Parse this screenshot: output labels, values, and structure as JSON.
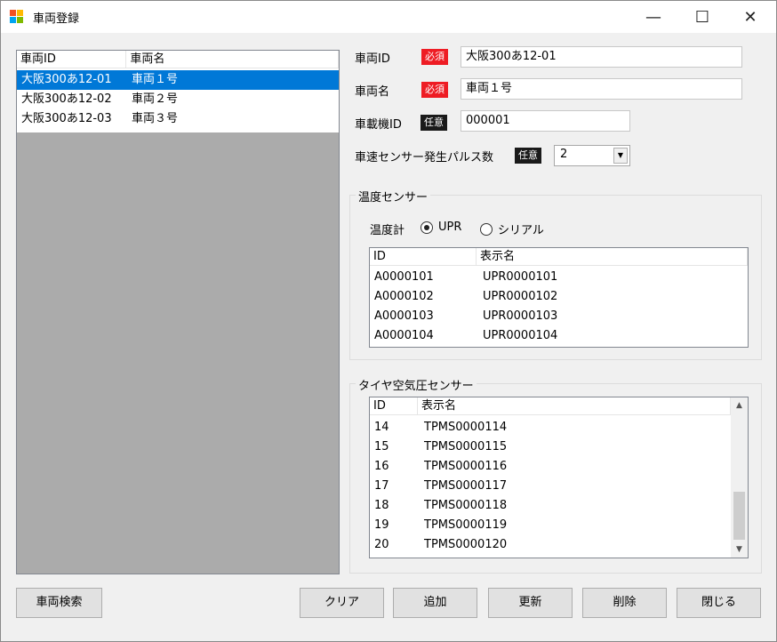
{
  "window": {
    "title": "車両登録",
    "minimize_glyph": "—",
    "maximize_glyph": "☐",
    "close_glyph": "✕"
  },
  "vehicle_list": {
    "columns": [
      "車両ID",
      "車両名"
    ],
    "rows": [
      [
        "大阪300あ12-01",
        "車両１号"
      ],
      [
        "大阪300あ12-02",
        "車両２号"
      ],
      [
        "大阪300あ12-03",
        "車両３号"
      ]
    ],
    "selected_index": 0
  },
  "form": {
    "vehicle_id": {
      "label": "車両ID",
      "tag": "必須",
      "value": "大阪300あ12-01"
    },
    "vehicle_name": {
      "label": "車両名",
      "tag": "必須",
      "value": "車両１号"
    },
    "device_id": {
      "label": "車載機ID",
      "tag": "任意",
      "value": "000001"
    },
    "pulse_count": {
      "label": "車速センサー発生パルス数",
      "tag": "任意",
      "value": "2"
    }
  },
  "temp_sensor": {
    "title": "温度センサー",
    "thermometer_label": "温度計",
    "options": [
      "UPR",
      "シリアル"
    ],
    "selected_option": "UPR",
    "columns": [
      "ID",
      "表示名"
    ],
    "rows": [
      [
        "A0000101",
        "UPR0000101"
      ],
      [
        "A0000102",
        "UPR0000102"
      ],
      [
        "A0000103",
        "UPR0000103"
      ],
      [
        "A0000104",
        "UPR0000104"
      ]
    ]
  },
  "tire_sensor": {
    "title": "タイヤ空気圧センサー",
    "columns": [
      "ID",
      "表示名"
    ],
    "rows": [
      [
        "14",
        "TPMS0000114"
      ],
      [
        "15",
        "TPMS0000115"
      ],
      [
        "16",
        "TPMS0000116"
      ],
      [
        "17",
        "TPMS0000117"
      ],
      [
        "18",
        "TPMS0000118"
      ],
      [
        "19",
        "TPMS0000119"
      ],
      [
        "20",
        "TPMS0000120"
      ]
    ]
  },
  "buttons": {
    "search": "車両検索",
    "clear": "クリア",
    "add": "追加",
    "update": "更新",
    "delete": "削除",
    "close": "閉じる"
  },
  "colors": {
    "selection": "#0078d7",
    "required_tag": "#ee1c24",
    "optional_tag": "#1a1a1a"
  }
}
